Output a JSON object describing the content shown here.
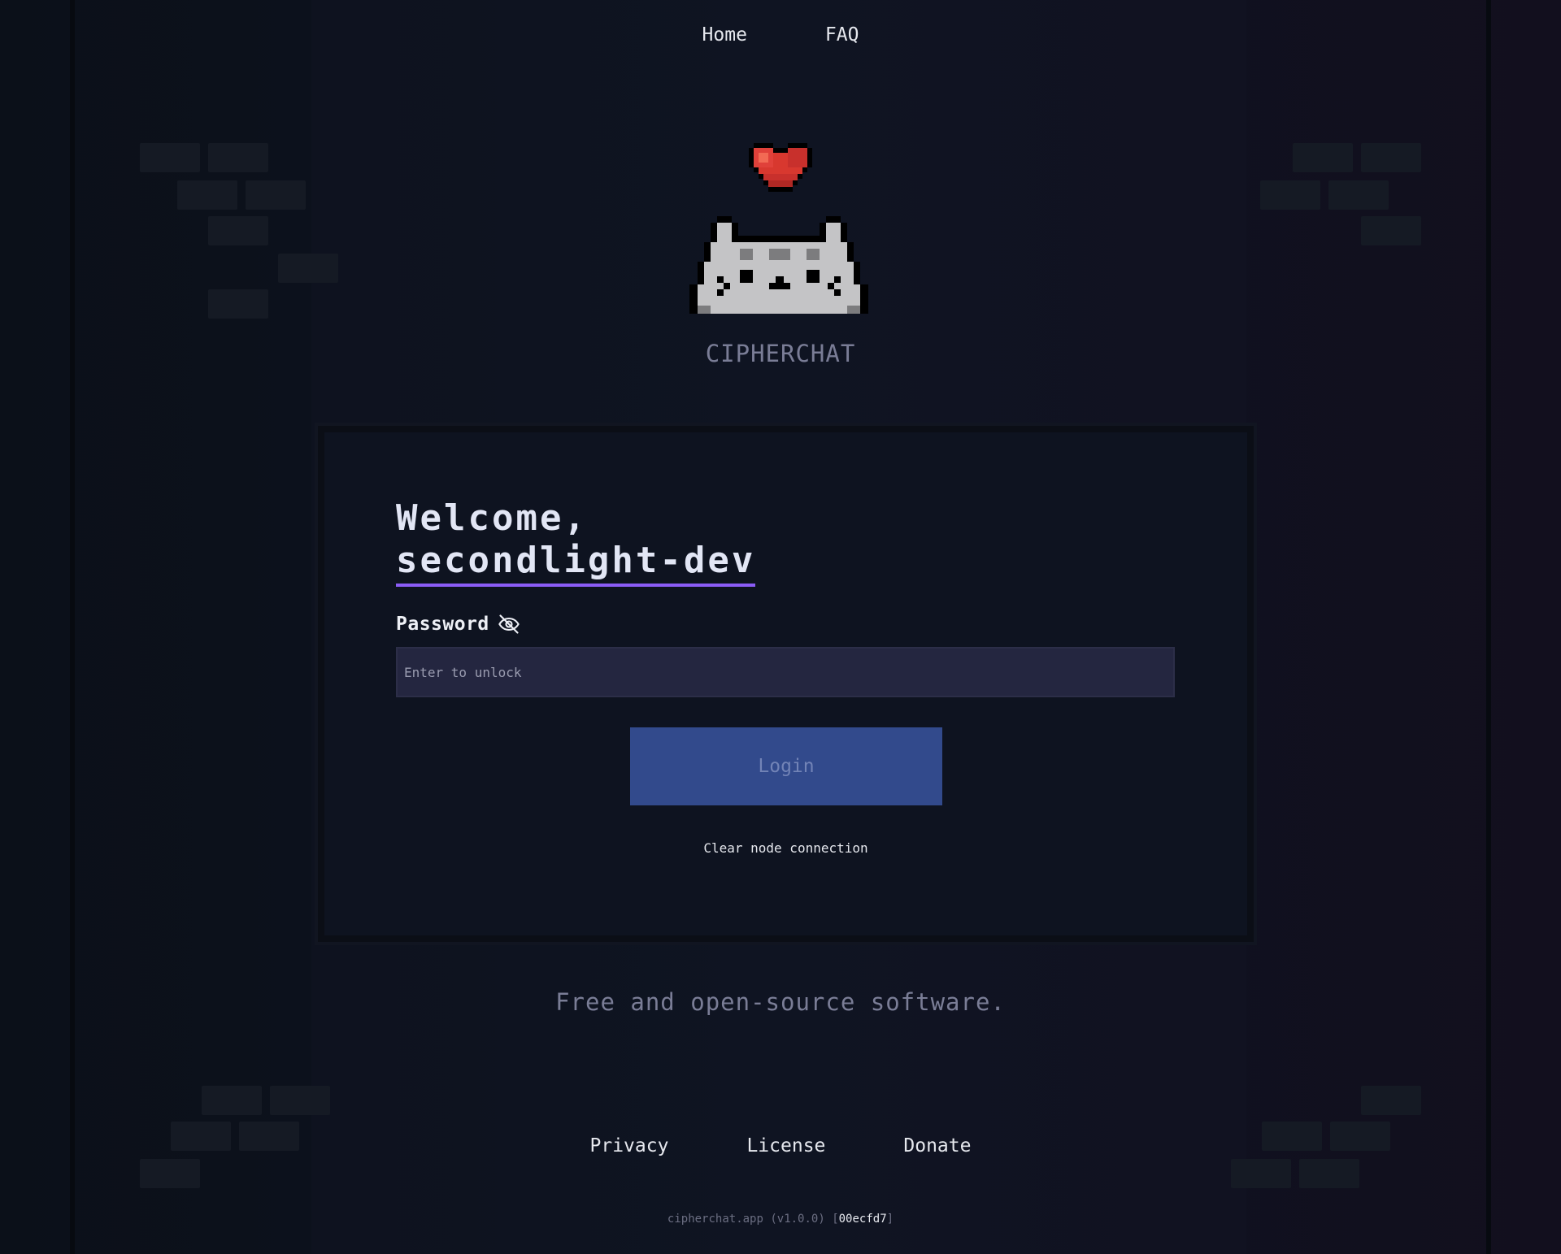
{
  "nav": {
    "home": "Home",
    "faq": "FAQ"
  },
  "brand": {
    "name": "CIPHERCHAT"
  },
  "card": {
    "welcome_prefix": "Welcome,",
    "username": "secondlight-dev",
    "password_label": "Password",
    "password_placeholder": "Enter to unlock",
    "password_value": "",
    "login_label": "Login",
    "clear_label": "Clear node connection"
  },
  "tagline": "Free and open-source software.",
  "footer": {
    "links": [
      "Privacy",
      "License",
      "Donate"
    ],
    "version_prefix": "cipherchat.app (v1.0.0) [",
    "version_hash": "00ecfd7",
    "version_suffix": "]"
  },
  "icons": {
    "visibility": "eye-off-icon",
    "heart": "heart-icon",
    "logo": "cat-logo-icon"
  },
  "colors": {
    "accent": "#8b5cf6",
    "button": "#324a8c",
    "background": "#0c111a"
  }
}
